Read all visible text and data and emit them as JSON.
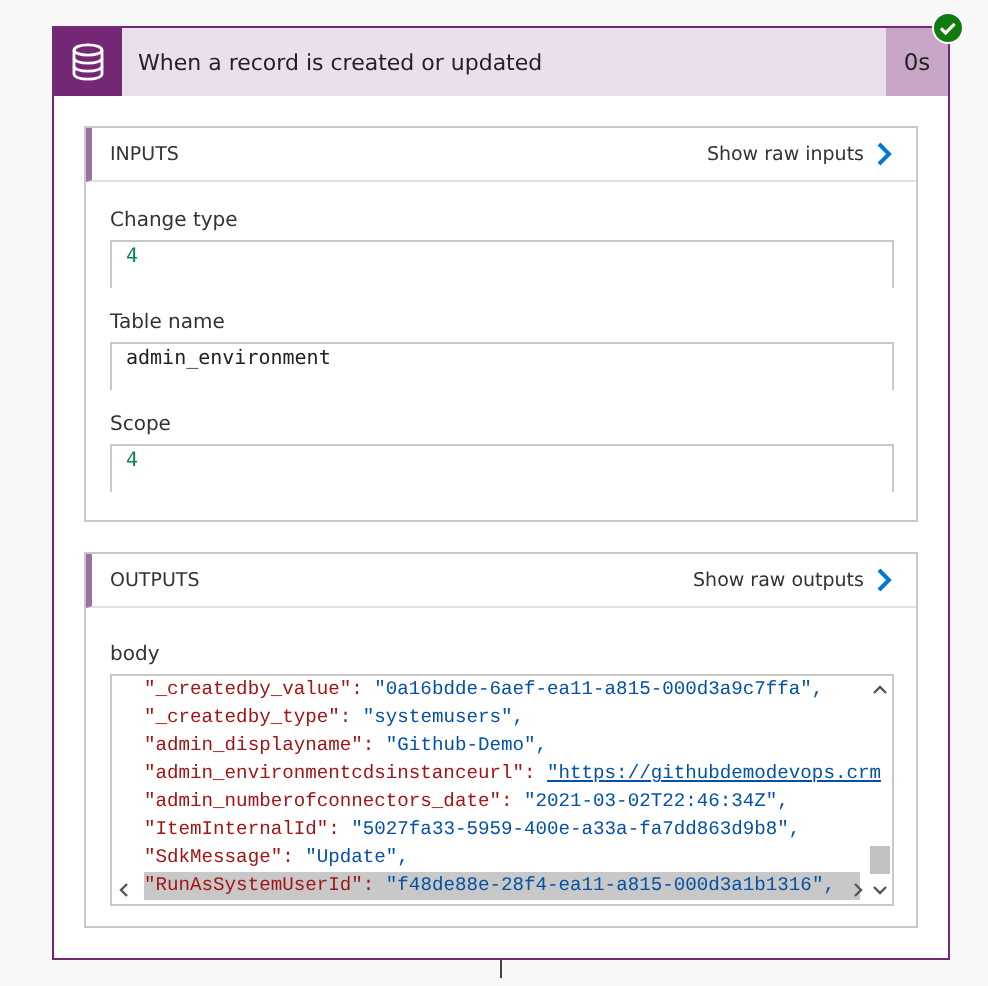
{
  "trigger": {
    "title": "When a record is created or updated",
    "duration": "0s",
    "succeeded": true
  },
  "inputs": {
    "heading": "INPUTS",
    "raw_link": "Show raw inputs",
    "fields": [
      {
        "label": "Change type",
        "value": "4",
        "kind": "number"
      },
      {
        "label": "Table name",
        "value": "admin_environment",
        "kind": "string"
      },
      {
        "label": "Scope",
        "value": "4",
        "kind": "number"
      }
    ]
  },
  "outputs": {
    "heading": "OUTPUTS",
    "raw_link": "Show raw outputs",
    "body_label": "body",
    "lines": [
      {
        "key": "\"_createdby_value\":",
        "value": "\"0a16bdde-6aef-ea11-a815-000d3a9c7ffa\",",
        "kind": "string",
        "selected": false
      },
      {
        "key": "\"_createdby_type\":",
        "value": "\"systemusers\",",
        "kind": "string",
        "selected": false
      },
      {
        "key": "\"admin_displayname\":",
        "value": "\"Github-Demo\",",
        "kind": "string",
        "selected": false
      },
      {
        "key": "\"admin_environmentcdsinstanceurl\":",
        "value": "\"https://githubdemodevops.crm",
        "kind": "link",
        "selected": false
      },
      {
        "key": "\"admin_numberofconnectors_date\":",
        "value": "\"2021-03-02T22:46:34Z\",",
        "kind": "string",
        "selected": false
      },
      {
        "key": "\"ItemInternalId\":",
        "value": "\"5027fa33-5959-400e-a33a-fa7dd863d9b8\",",
        "kind": "string",
        "selected": false
      },
      {
        "key": "\"SdkMessage\":",
        "value": "\"Update\",",
        "kind": "string",
        "selected": false
      },
      {
        "key": "\"RunAsSystemUserId\":",
        "value": "\"f48de88e-28f4-ea11-a815-000d3a1b1316\",",
        "kind": "string",
        "selected": true
      }
    ]
  }
}
